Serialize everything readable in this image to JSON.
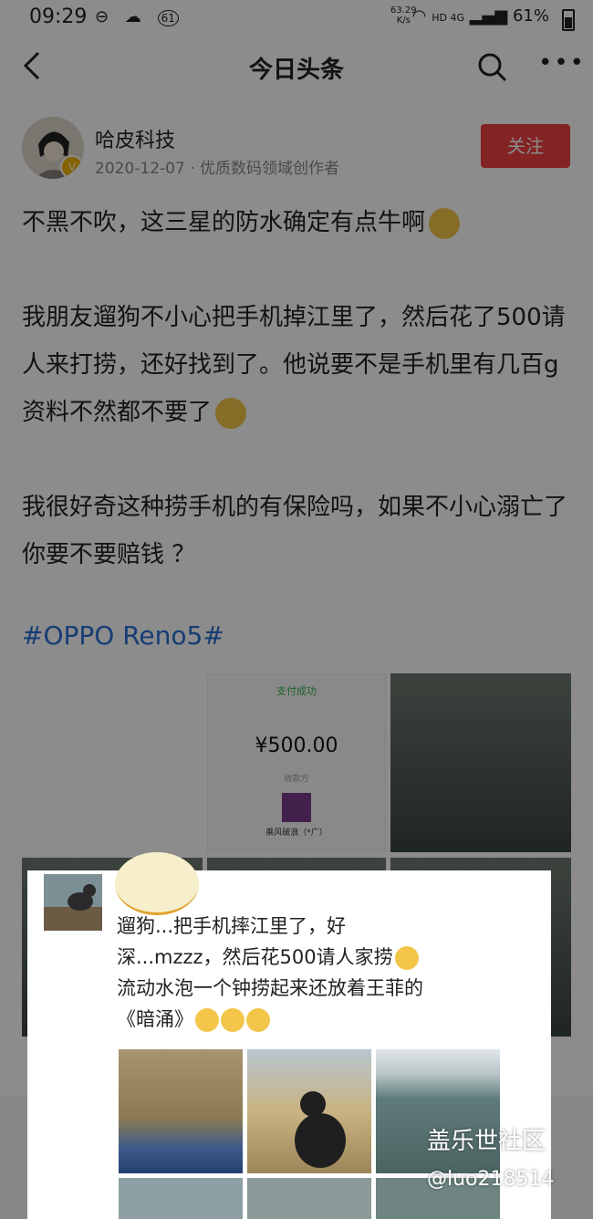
{
  "status_bar": {
    "time": "09:29",
    "notification_count": "61",
    "speed_value": "63.29",
    "speed_unit": "K/s",
    "network": "HD 4G",
    "battery": "61%"
  },
  "header": {
    "title": "今日头条"
  },
  "author": {
    "name": "哈皮科技",
    "meta": "2020-12-07 · 优质数码领域创作者",
    "follow_label": "关注",
    "verified_badge": "V"
  },
  "post": {
    "p1": "不黑不吹，这三星的防水确定有点牛啊",
    "p2": "我朋友遛狗不小心把手机掉江里了，然后花了500请人来打捞，还好找到了。他说要不是手机里有几百g资料不然都不要了",
    "p3": "我很好奇这种捞手机的有保险吗，如果不小心溺亡了你要不要赔钱 ？",
    "hashtag": "#OPPO Reno5#"
  },
  "payment_image": {
    "status": "支付成功",
    "amount": "¥500.00",
    "payee_label": "收款方",
    "payee_name": "乘风破浪（*广）"
  },
  "popup": {
    "text_line1": "遛狗...把手机摔江里了，好",
    "text_line2": "深...mzzz，然后花500请人家捞",
    "text_line3": "流动水泡一个钟捞起来还放着王菲的",
    "text_line4": "《暗涌》"
  },
  "watermark": {
    "line1": "盖乐世社区",
    "line2": "@luo218514"
  }
}
